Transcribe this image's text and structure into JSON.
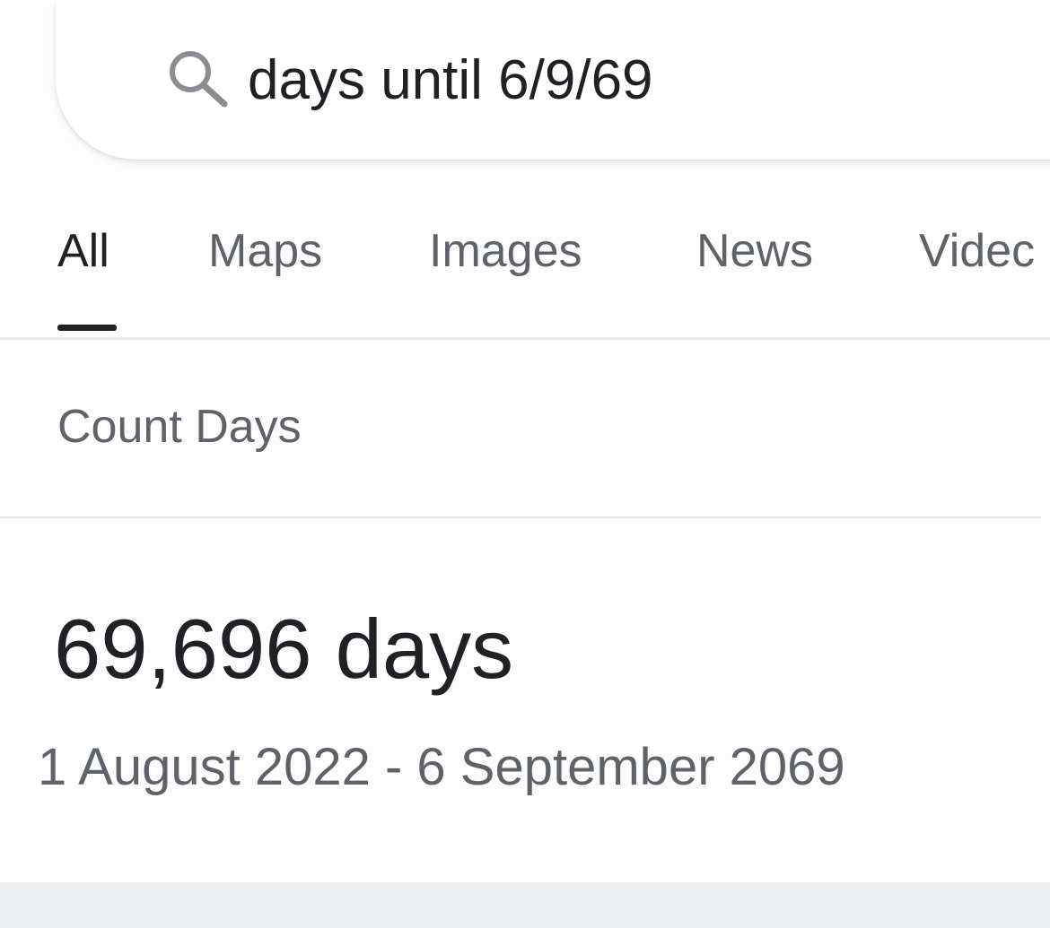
{
  "search": {
    "query": "days until 6/9/69",
    "icon": "search-icon"
  },
  "tabs": [
    {
      "label": "All",
      "active": true
    },
    {
      "label": "Maps",
      "active": false
    },
    {
      "label": "Images",
      "active": false
    },
    {
      "label": "News",
      "active": false
    },
    {
      "label": "Videc",
      "active": false
    }
  ],
  "result": {
    "title": "Count Days",
    "days": "69,696 days",
    "range": "1 August 2022 - 6 September 2069"
  },
  "colors": {
    "text_primary": "#202124",
    "text_secondary": "#5f6368",
    "divider": "#ebebeb"
  }
}
